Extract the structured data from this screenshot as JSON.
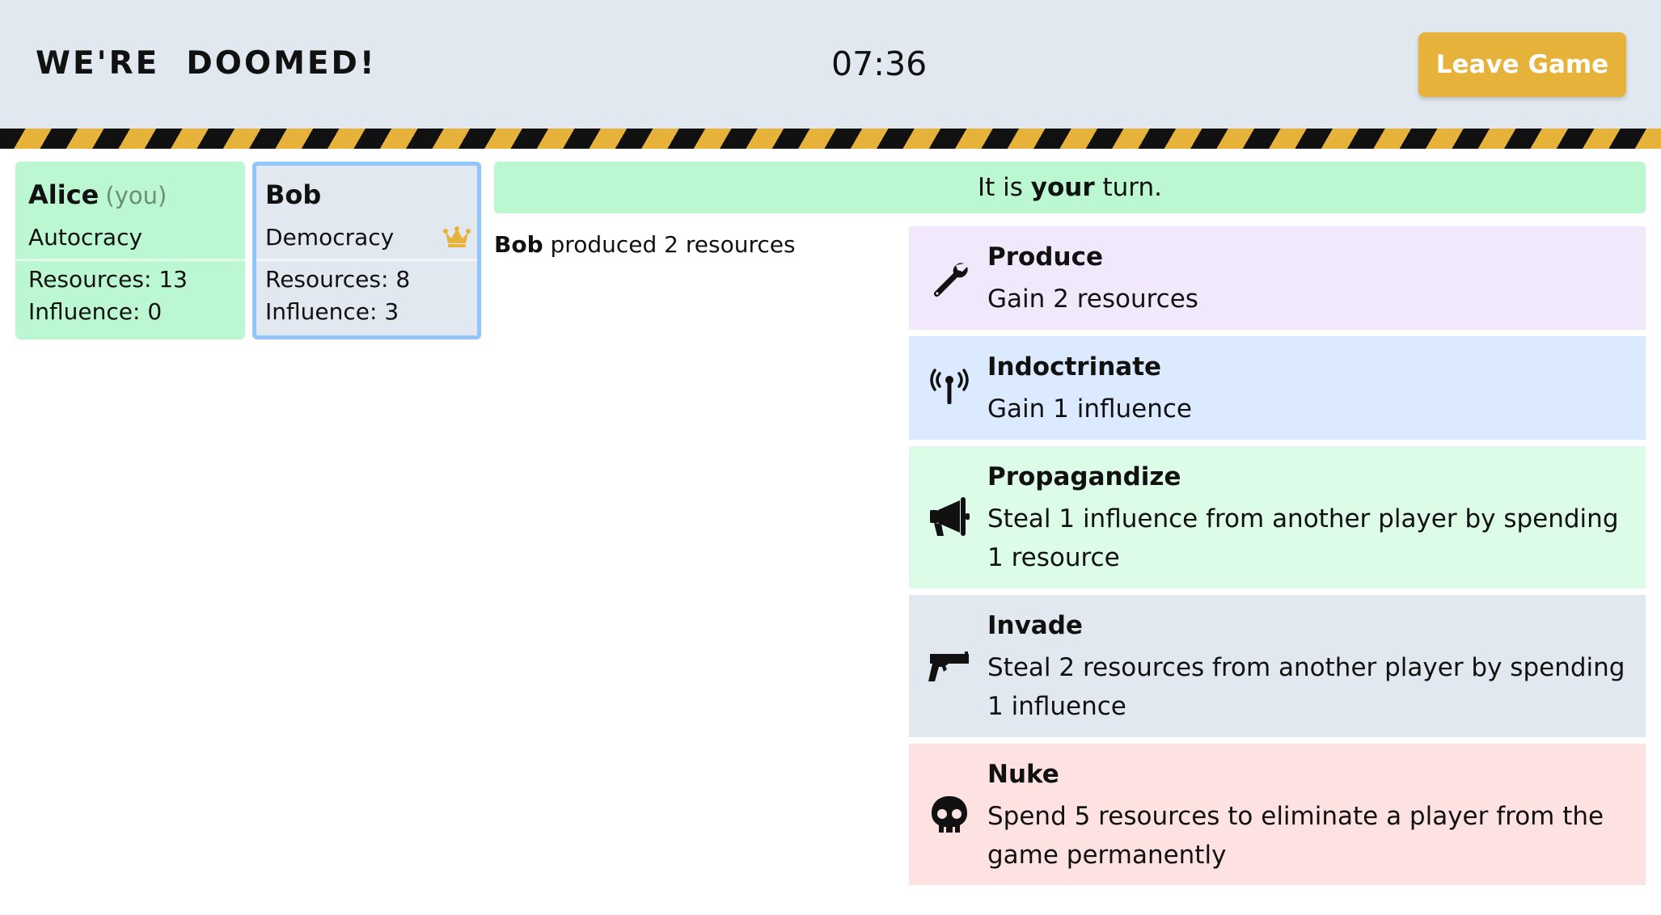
{
  "header": {
    "title": "WE'RE  DOOMED!",
    "timer": "07:36",
    "leave_label": "Leave Game"
  },
  "colors": {
    "accent": "#e6b23a",
    "header_bg": "#e2e8f0",
    "you_card_bg": "#bbf7d0",
    "active_border": "#93c5fd"
  },
  "players": [
    {
      "name": "Alice",
      "you_tag": "(you)",
      "government": "Autocracy",
      "resources": "Resources: 13",
      "influence": "Influence: 0"
    },
    {
      "name": "Bob",
      "government": "Democracy",
      "resources": "Resources: 8",
      "influence": "Influence: 3",
      "badge_icon": "crown-icon"
    }
  ],
  "turn": {
    "prefix": "It is ",
    "emphasis": "your",
    "suffix": " turn."
  },
  "log": [
    {
      "actor": "Bob",
      "text": " produced 2 resources"
    }
  ],
  "actions": [
    {
      "icon": "wrench-icon",
      "title": "Produce",
      "description": "Gain 2 resources"
    },
    {
      "icon": "antenna-icon",
      "title": "Indoctrinate",
      "description": "Gain 1 influence"
    },
    {
      "icon": "megaphone-icon",
      "title": "Propagandize",
      "description": "Steal 1 influence from another player by spending 1 resource"
    },
    {
      "icon": "gun-icon",
      "title": "Invade",
      "description": "Steal 2 resources from another player by spending 1 influence"
    },
    {
      "icon": "skull-icon",
      "title": "Nuke",
      "description": "Spend 5 resources to eliminate a player from the game permanently"
    }
  ]
}
